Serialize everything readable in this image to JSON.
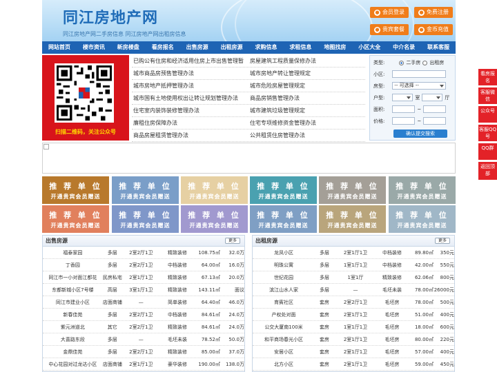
{
  "header": {
    "logo": "同江房地产网",
    "subtitle": "同江房地产网二手房信息    同江房地产网出租房信息",
    "buttons": [
      {
        "label": "会员登录",
        "icon": "user-icon"
      },
      {
        "label": "免费注册",
        "icon": "register-icon"
      },
      {
        "label": "贵宾套餐",
        "icon": "vip-icon"
      },
      {
        "label": "金币充值",
        "icon": "coin-icon"
      }
    ]
  },
  "nav": [
    "网站首页",
    "楼市资讯",
    "新房楼盘",
    "看房报名",
    "出售房源",
    "出租房源",
    "求购信息",
    "求租信息",
    "地图找房",
    "小区大全",
    "中介名录",
    "联系客服"
  ],
  "qr": {
    "caption": "扫描二维码，关注公众号"
  },
  "links": [
    [
      "已购公有住房和经济适用住房上市出售管理暂",
      "房屋建筑工程质量保修办法"
    ],
    [
      "城市商品房预售管理办法",
      "城市房地产转让管理规定"
    ],
    [
      "城市房地产抵押管理办法",
      "城市危险房屋管理规定"
    ],
    [
      "城市国有土地使用权出让转让规划管理办法",
      "商品房销售管理办法"
    ],
    [
      "住宅室内装饰装修管理办法",
      "城市建筑垃圾管理规定"
    ],
    [
      "廉租住房保障办法",
      "住宅专项维修资金管理办法"
    ],
    [
      "商品房屋租赁管理办法",
      "公共租赁住房管理办法"
    ]
  ],
  "search": {
    "type_label": "类型:",
    "opt_sale": "二手房",
    "opt_rent": "出租房",
    "community_label": "小区:",
    "housetype_label": "房型:",
    "housetype_value": "-- 可选择 --",
    "layout_label": "户型:",
    "room_unit": "室",
    "hall_unit": "厅",
    "area_label": "面积:",
    "price_label": "价格:",
    "tilde": "~",
    "submit": "确认提交搜索"
  },
  "recommend": {
    "title": "推 荐 单 位",
    "sub": "开通贵宾会员赠送"
  },
  "colors": {
    "rec": [
      "#b8792c",
      "#7a9ec8",
      "#e6d0a3",
      "#4aa1b0",
      "#a49f97",
      "#9aa9a8",
      "#e1805d",
      "#7f97c9",
      "#a199cf",
      "#7f9fc4",
      "#b9a57c",
      "#a0b7c7"
    ],
    "accent": "#1e64b4",
    "orange": "#f07d1a",
    "red": "#e32228"
  },
  "sale": {
    "title": "出售房源",
    "more": "更多",
    "rows": [
      [
        "福泰家园",
        "多层",
        "2室2厅1卫",
        "精致装修",
        "108.75㎡",
        "32.0万"
      ],
      [
        "丁香园",
        "多层",
        "2室2厅1卫",
        "中档装修",
        "64.00㎡",
        "16.0万"
      ],
      [
        "同江市一小对面江都花",
        "民房私宅",
        "2室1厅1卫",
        "精致装修",
        "67.13㎡",
        "20.0万"
      ],
      [
        "东都新城小区7号楼",
        "高层",
        "3室1厅1卫",
        "精致装修",
        "143.11㎡",
        "面议"
      ],
      [
        "同江市建业小区",
        "店面商铺",
        "—",
        "简单装修",
        "64.40㎡",
        "46.0万"
      ],
      [
        "新春佳苑",
        "多层",
        "2室2厅1卫",
        "中档装修",
        "84.61㎡",
        "24.0万"
      ],
      [
        "紫元洲道北",
        "其它",
        "2室2厅1卫",
        "精致装修",
        "84.61㎡",
        "24.0万"
      ],
      [
        "大喜路东段",
        "多层",
        "—",
        "毛坯未装",
        "78.52㎡",
        "50.0万"
      ],
      [
        "金鼎佳苑",
        "多层",
        "2室2厅1卫",
        "精致装修",
        "85.00㎡",
        "37.0万"
      ],
      [
        "中心花园对过龙达小区",
        "店面商铺",
        "2室1厅1卫",
        "豪华装修",
        "190.00㎡",
        "138.0万"
      ]
    ]
  },
  "rent": {
    "title": "出租房源",
    "more": "更多",
    "rows": [
      [
        "龙凤小区",
        "多层",
        "2室1厅1卫",
        "中档装修",
        "89.80㎡",
        "350元"
      ],
      [
        "明珠公寓",
        "多层",
        "1室1厅1卫",
        "中档装修",
        "42.00㎡",
        "550元"
      ],
      [
        "世纪花园",
        "多层",
        "1室1厅",
        "精致装修",
        "62.06㎡",
        "800元"
      ],
      [
        "滨江山水人家",
        "多层",
        "—",
        "毛坯未装",
        "78.00㎡",
        "26000元"
      ],
      [
        "育賓社区",
        "套房",
        "2室2厅1卫",
        "毛坯房",
        "78.00㎡",
        "500元"
      ],
      [
        "产权处对面",
        "套房",
        "2室1厅1卫",
        "毛坯房",
        "51.00㎡",
        "400元"
      ],
      [
        "公交大厦南100米",
        "套房",
        "1室1厅1卫",
        "毛坯房",
        "18.00㎡",
        "600元"
      ],
      [
        "和平商场春光小区",
        "套房",
        "2室1厅1卫",
        "毛坯房",
        "80.00㎡",
        "220元"
      ],
      [
        "安居小区",
        "套房",
        "2室1厅1卫",
        "毛坯房",
        "57.00㎡",
        "400元"
      ],
      [
        "北方小区",
        "套房",
        "2室1厅1卫",
        "毛坯房",
        "59.00㎡",
        "450元"
      ]
    ]
  },
  "sidebar": [
    "看房报名",
    "客服微信",
    "公众号",
    "客服QQ号",
    "QQ群",
    "返回顶部"
  ]
}
